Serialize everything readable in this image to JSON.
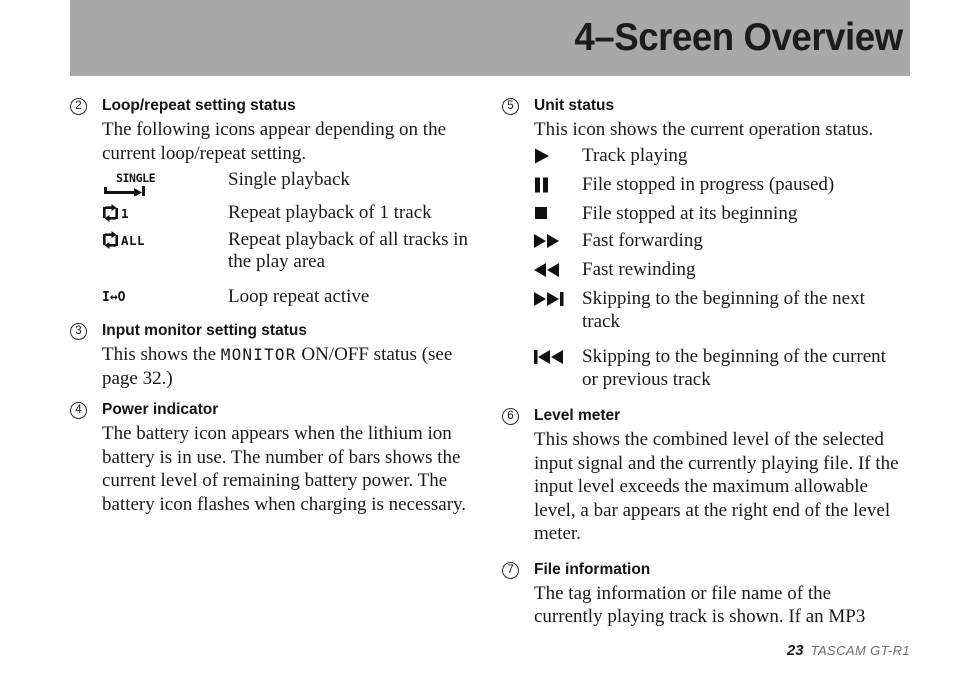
{
  "page": {
    "header_title": "4–Screen Overview",
    "band_color": "#a8a8a8",
    "footer_page_number": "23",
    "footer_model": "TASCAM  GT-R1"
  },
  "left_column": {
    "item2": {
      "number": "2",
      "heading": "Loop/repeat setting status",
      "intro": "The following icons appear depending on the current loop/repeat setting.",
      "rows": [
        {
          "icon": "single-playback-lcd-icon",
          "icon_text": "SINGLE",
          "description": "Single playback"
        },
        {
          "icon": "repeat-one-lcd-icon",
          "icon_text": "1",
          "description": "Repeat playback of 1 track"
        },
        {
          "icon": "repeat-all-lcd-icon",
          "icon_text": "ALL",
          "description": "Repeat playback of all tracks in the play area"
        },
        {
          "icon": "loop-io-lcd-icon",
          "icon_text": "I↔O",
          "description": "Loop repeat active"
        }
      ]
    },
    "item3": {
      "number": "3",
      "heading": "Input monitor setting status",
      "text_before": "This shows the ",
      "mono_term": "MONITOR",
      "text_after": " ON/OFF status (see page 32.)"
    },
    "item4": {
      "number": "4",
      "heading": "Power indicator",
      "body": "The battery icon appears when the lithium ion battery is in use. The number of bars shows the current level of remaining battery power. The battery icon flashes when charging is necessary."
    }
  },
  "right_column": {
    "item5": {
      "number": "5",
      "heading": "Unit status",
      "intro": "This icon shows the current operation status.",
      "rows": [
        {
          "icon": "play-icon",
          "description": "Track playing"
        },
        {
          "icon": "pause-icon",
          "description": "File stopped in progress (paused)"
        },
        {
          "icon": "stop-icon",
          "description": "File stopped at its beginning"
        },
        {
          "icon": "fast-forward-icon",
          "description": "Fast forwarding"
        },
        {
          "icon": "fast-rewind-icon",
          "description": "Fast rewinding"
        },
        {
          "icon": "skip-next-icon",
          "description": "Skipping to the beginning of the next track"
        },
        {
          "icon": "skip-previous-icon",
          "description": "Skipping to the beginning of the current or previous track"
        }
      ]
    },
    "item6": {
      "number": "6",
      "heading": "Level meter",
      "body": "This shows the combined level of the selected input signal and the currently playing file. If the input level exceeds the maximum allowable level, a bar appears at the right end of the level meter."
    },
    "item7": {
      "number": "7",
      "heading": "File information",
      "body": "The tag information or file name of the currently playing track is shown. If an MP3"
    }
  }
}
